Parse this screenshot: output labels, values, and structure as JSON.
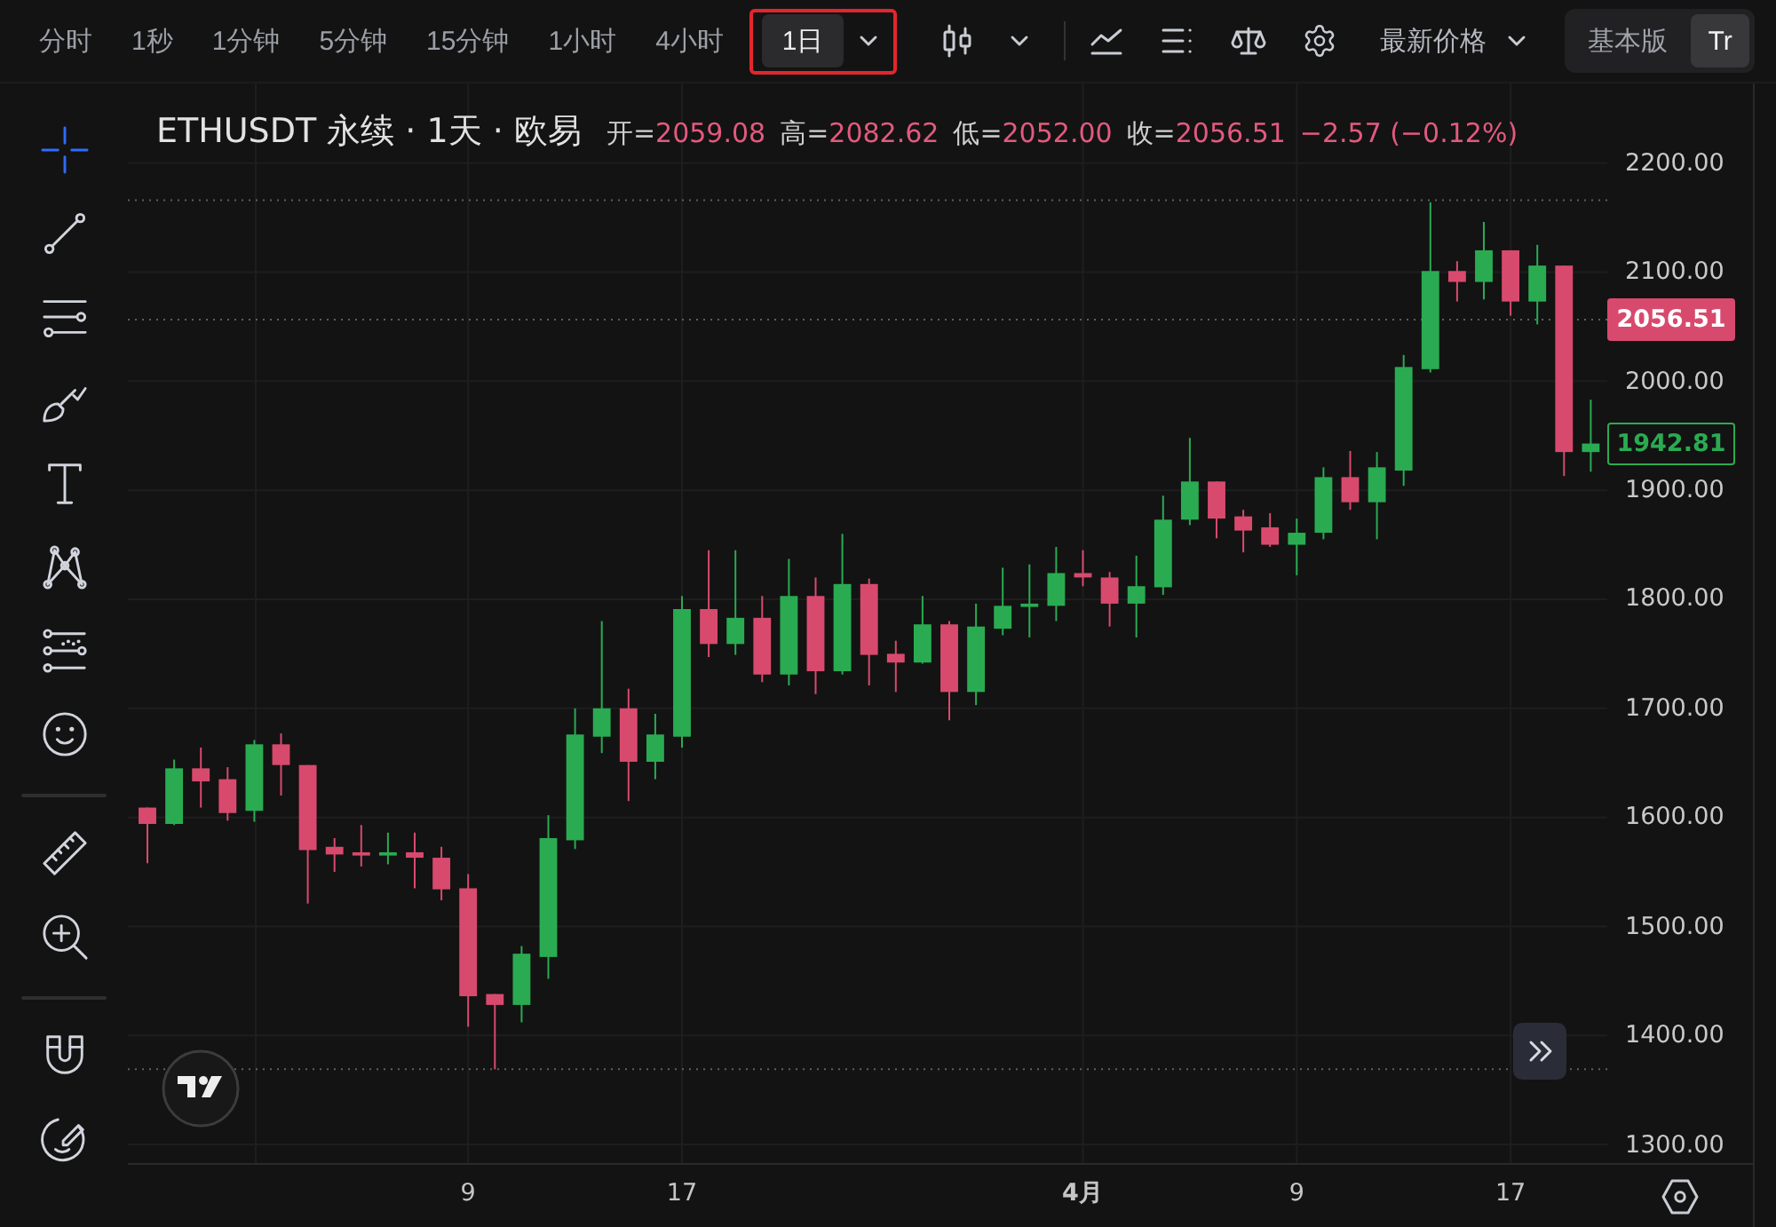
{
  "toolbar": {
    "intervals": [
      {
        "label": "分时",
        "selected": false,
        "highlighted": false
      },
      {
        "label": "1秒",
        "selected": false,
        "highlighted": false
      },
      {
        "label": "1分钟",
        "selected": false,
        "highlighted": false
      },
      {
        "label": "5分钟",
        "selected": false,
        "highlighted": false
      },
      {
        "label": "15分钟",
        "selected": false,
        "highlighted": false
      },
      {
        "label": "1小时",
        "selected": false,
        "highlighted": false
      },
      {
        "label": "4小时",
        "selected": false,
        "highlighted": false
      },
      {
        "label": "1日",
        "selected": true,
        "highlighted": true
      }
    ],
    "price_source": "最新价格",
    "modes": [
      {
        "label": "基本版",
        "selected": false
      },
      {
        "label": "Tr",
        "selected": true
      }
    ]
  },
  "drawing_tools": {
    "groups": [
      {
        "tools": [
          {
            "kind": "crosshair",
            "selected": true
          },
          {
            "kind": "trendline",
            "selected": false
          },
          {
            "kind": "hlines",
            "selected": false
          },
          {
            "kind": "brush",
            "selected": false
          },
          {
            "kind": "text",
            "selected": false
          },
          {
            "kind": "pattern",
            "selected": false
          },
          {
            "kind": "fib",
            "selected": false
          },
          {
            "kind": "emoji",
            "selected": false
          }
        ]
      },
      {
        "tools": [
          {
            "kind": "ruler",
            "selected": false
          },
          {
            "kind": "zoom",
            "selected": false
          }
        ]
      },
      {
        "tools": [
          {
            "kind": "magnet",
            "selected": false
          },
          {
            "kind": "pencil",
            "selected": false
          }
        ]
      }
    ]
  },
  "chart": {
    "legend": {
      "symbol": "ETHUSDT 永续 · 1天 · 欧易",
      "fields": [
        {
          "label": "开=",
          "value": "2059.08"
        },
        {
          "label": "高=",
          "value": "2082.62"
        },
        {
          "label": "低=",
          "value": "2052.00"
        },
        {
          "label": "收=",
          "value": "2056.51"
        }
      ],
      "change": "−2.57 (−0.12%)"
    },
    "price_tags": [
      {
        "value": "2056.51",
        "kind": "filled",
        "color": "#d84a6d"
      },
      {
        "value": "1942.81",
        "kind": "outline",
        "color": "#2aab52"
      }
    ],
    "time_axis": [
      {
        "kind": "day"
      },
      {
        "kind": "day"
      },
      {
        "kind": "month"
      },
      {
        "kind": "day"
      },
      {
        "kind": "day"
      }
    ],
    "chart_data": {
      "type": "candlestick",
      "categories": [
        null,
        null,
        null,
        null,
        null,
        null,
        null,
        null,
        null,
        null,
        null,
        null,
        "9",
        null,
        null,
        null,
        null,
        null,
        null,
        null,
        "17",
        null,
        null,
        null,
        null,
        null,
        null,
        null,
        null,
        null,
        null,
        null,
        null,
        null,
        null,
        "4月",
        null,
        null,
        null,
        null,
        null,
        null,
        null,
        "9",
        null,
        null,
        null,
        null,
        null,
        null,
        null,
        "17",
        null,
        null,
        null
      ],
      "ohlc": [
        [
          1609,
          1609,
          1558,
          1594
        ],
        [
          1594,
          1653,
          1593,
          1645
        ],
        [
          1645,
          1664,
          1609,
          1633
        ],
        [
          1635,
          1646,
          1597,
          1604
        ],
        [
          1606,
          1671,
          1596,
          1667
        ],
        [
          1667,
          1677,
          1620,
          1648
        ],
        [
          1648,
          1648,
          1521,
          1570
        ],
        [
          1573,
          1581,
          1550,
          1566
        ],
        [
          1568,
          1593,
          1555,
          1565
        ],
        [
          1565,
          1586,
          1557,
          1568
        ],
        [
          1568,
          1586,
          1535,
          1563
        ],
        [
          1563,
          1573,
          1524,
          1534
        ],
        [
          1535,
          1548,
          1408,
          1436
        ],
        [
          1438,
          1438,
          1369,
          1428
        ],
        [
          1428,
          1482,
          1412,
          1475
        ],
        [
          1472,
          1602,
          1452,
          1581
        ],
        [
          1579,
          1700,
          1571,
          1676
        ],
        [
          1674,
          1780,
          1659,
          1700
        ],
        [
          1700,
          1718,
          1615,
          1651
        ],
        [
          1651,
          1695,
          1635,
          1676
        ],
        [
          1674,
          1803,
          1664,
          1791
        ],
        [
          1791,
          1845,
          1747,
          1759
        ],
        [
          1759,
          1845,
          1749,
          1783
        ],
        [
          1783,
          1803,
          1724,
          1731
        ],
        [
          1731,
          1837,
          1721,
          1803
        ],
        [
          1803,
          1820,
          1713,
          1734
        ],
        [
          1734,
          1860,
          1731,
          1814
        ],
        [
          1814,
          1819,
          1721,
          1749
        ],
        [
          1750,
          1762,
          1715,
          1742
        ],
        [
          1742,
          1803,
          1741,
          1777
        ],
        [
          1777,
          1780,
          1689,
          1715
        ],
        [
          1715,
          1796,
          1703,
          1775
        ],
        [
          1773,
          1829,
          1767,
          1794
        ],
        [
          1793,
          1832,
          1765,
          1796
        ],
        [
          1794,
          1848,
          1780,
          1824
        ],
        [
          1824,
          1845,
          1812,
          1820
        ],
        [
          1820,
          1825,
          1775,
          1796
        ],
        [
          1796,
          1840,
          1765,
          1812
        ],
        [
          1811,
          1895,
          1804,
          1873
        ],
        [
          1873,
          1948,
          1868,
          1908
        ],
        [
          1908,
          1908,
          1856,
          1874
        ],
        [
          1876,
          1882,
          1843,
          1863
        ],
        [
          1866,
          1879,
          1848,
          1850
        ],
        [
          1850,
          1874,
          1822,
          1861
        ],
        [
          1861,
          1921,
          1855,
          1912
        ],
        [
          1912,
          1936,
          1882,
          1889
        ],
        [
          1889,
          1935,
          1855,
          1921
        ],
        [
          1918,
          2024,
          1904,
          2013
        ],
        [
          2011,
          2164,
          2008,
          2101
        ],
        [
          2101,
          2110,
          2073,
          2091
        ],
        [
          2091,
          2146,
          2075,
          2120
        ],
        [
          2120,
          2120,
          2060,
          2073
        ],
        [
          2073,
          2125,
          2052,
          2106
        ],
        [
          2106,
          2106,
          1913,
          1935
        ],
        [
          1935,
          1983,
          1917,
          1942.81
        ]
      ],
      "ylim": [
        1283,
        2273
      ],
      "yticks": [
        {
          "value": 2200,
          "label": "2200.00"
        },
        {
          "value": 2100,
          "label": "2100.00"
        },
        {
          "value": 2000,
          "label": "2000.00"
        },
        {
          "value": 1900,
          "label": "1900.00"
        },
        {
          "value": 1800,
          "label": "1800.00"
        },
        {
          "value": 1700,
          "label": "1700.00"
        },
        {
          "value": 1600,
          "label": "1600.00"
        },
        {
          "value": 1500,
          "label": "1500.00"
        },
        {
          "value": 1400,
          "label": "1400.00"
        },
        {
          "value": 1300,
          "label": "1300.00"
        }
      ],
      "grid": true,
      "ref_lines": [
        {
          "axis": "y",
          "value": 2166
        },
        {
          "axis": "y",
          "value": 2056.51
        },
        {
          "axis": "y",
          "value": 1369
        }
      ]
    }
  }
}
